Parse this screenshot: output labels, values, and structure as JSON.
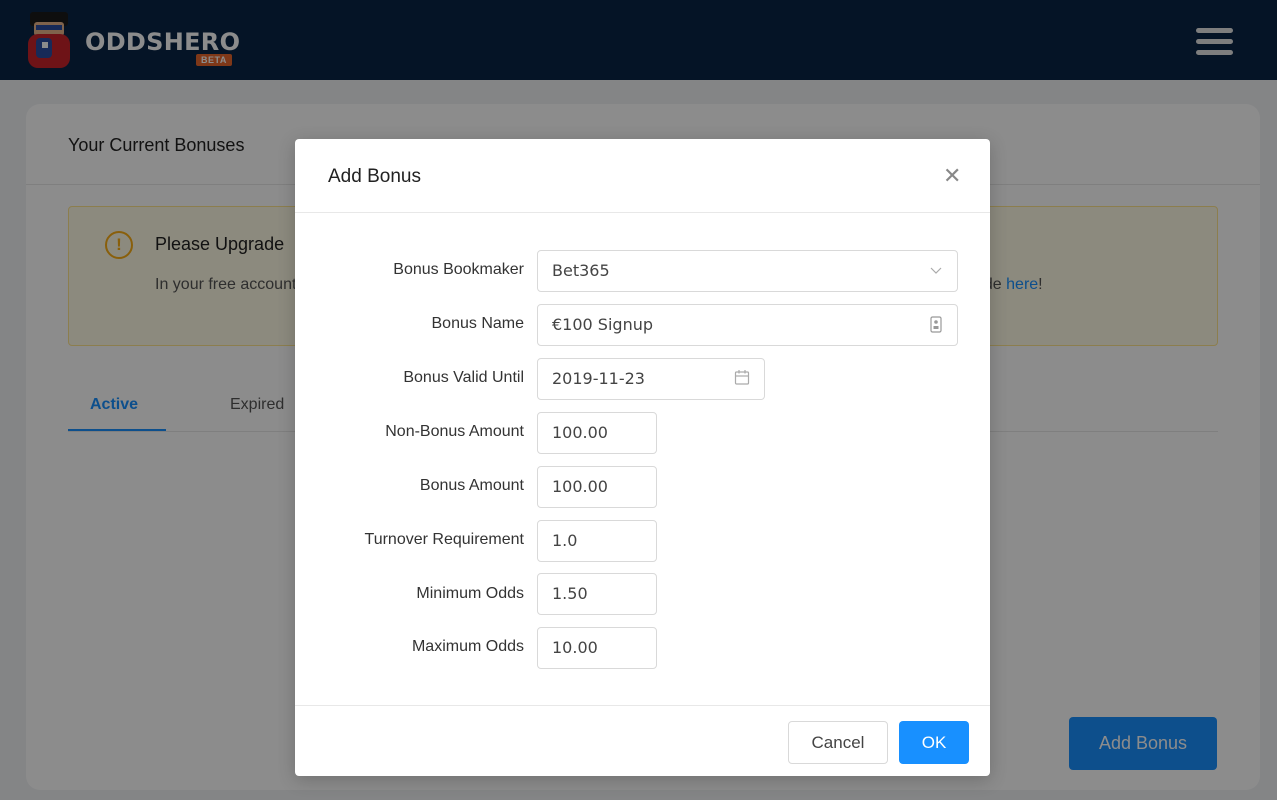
{
  "header": {
    "brand": "ODDSHERO",
    "badge": "BETA",
    "logo_icon": "superhero-mascot-icon",
    "menu_icon": "hamburger-menu-icon"
  },
  "card": {
    "title": "Your Current Bonuses",
    "alert": {
      "icon": "warning-exclamation-icon",
      "title": "Please Upgrade",
      "text_before": "In your free account you can only add bonuses for a limited number of bookmakers. For all bookmakers please upgrade ",
      "link": "here",
      "text_after": "!"
    },
    "tabs": [
      "Active",
      "Expired"
    ],
    "add_button": "Add Bonus"
  },
  "modal": {
    "title": "Add Bonus",
    "close_icon": "close-icon",
    "fields": [
      {
        "label": "Bonus Bookmaker",
        "value": "Bet365",
        "type": "select",
        "icon": "chevron-down-icon"
      },
      {
        "label": "Bonus Name",
        "value": "€100 Signup",
        "type": "text",
        "icon": "contact-card-icon"
      },
      {
        "label": "Bonus Valid Until",
        "value": "2019-11-23",
        "type": "date",
        "icon": "calendar-icon"
      },
      {
        "label": "Non-Bonus Amount",
        "value": "100.00",
        "type": "number"
      },
      {
        "label": "Bonus Amount",
        "value": "100.00",
        "type": "number"
      },
      {
        "label": "Turnover Requirement",
        "value": "1.0",
        "type": "number"
      },
      {
        "label": "Minimum Odds",
        "value": "1.50",
        "type": "number"
      },
      {
        "label": "Maximum Odds",
        "value": "10.00",
        "type": "number"
      }
    ],
    "cancel": "Cancel",
    "ok": "OK"
  },
  "colors": {
    "header_bg": "#0a2646",
    "primary": "#1890ff",
    "warning": "#faad14",
    "beta_badge": "#e8672d"
  }
}
